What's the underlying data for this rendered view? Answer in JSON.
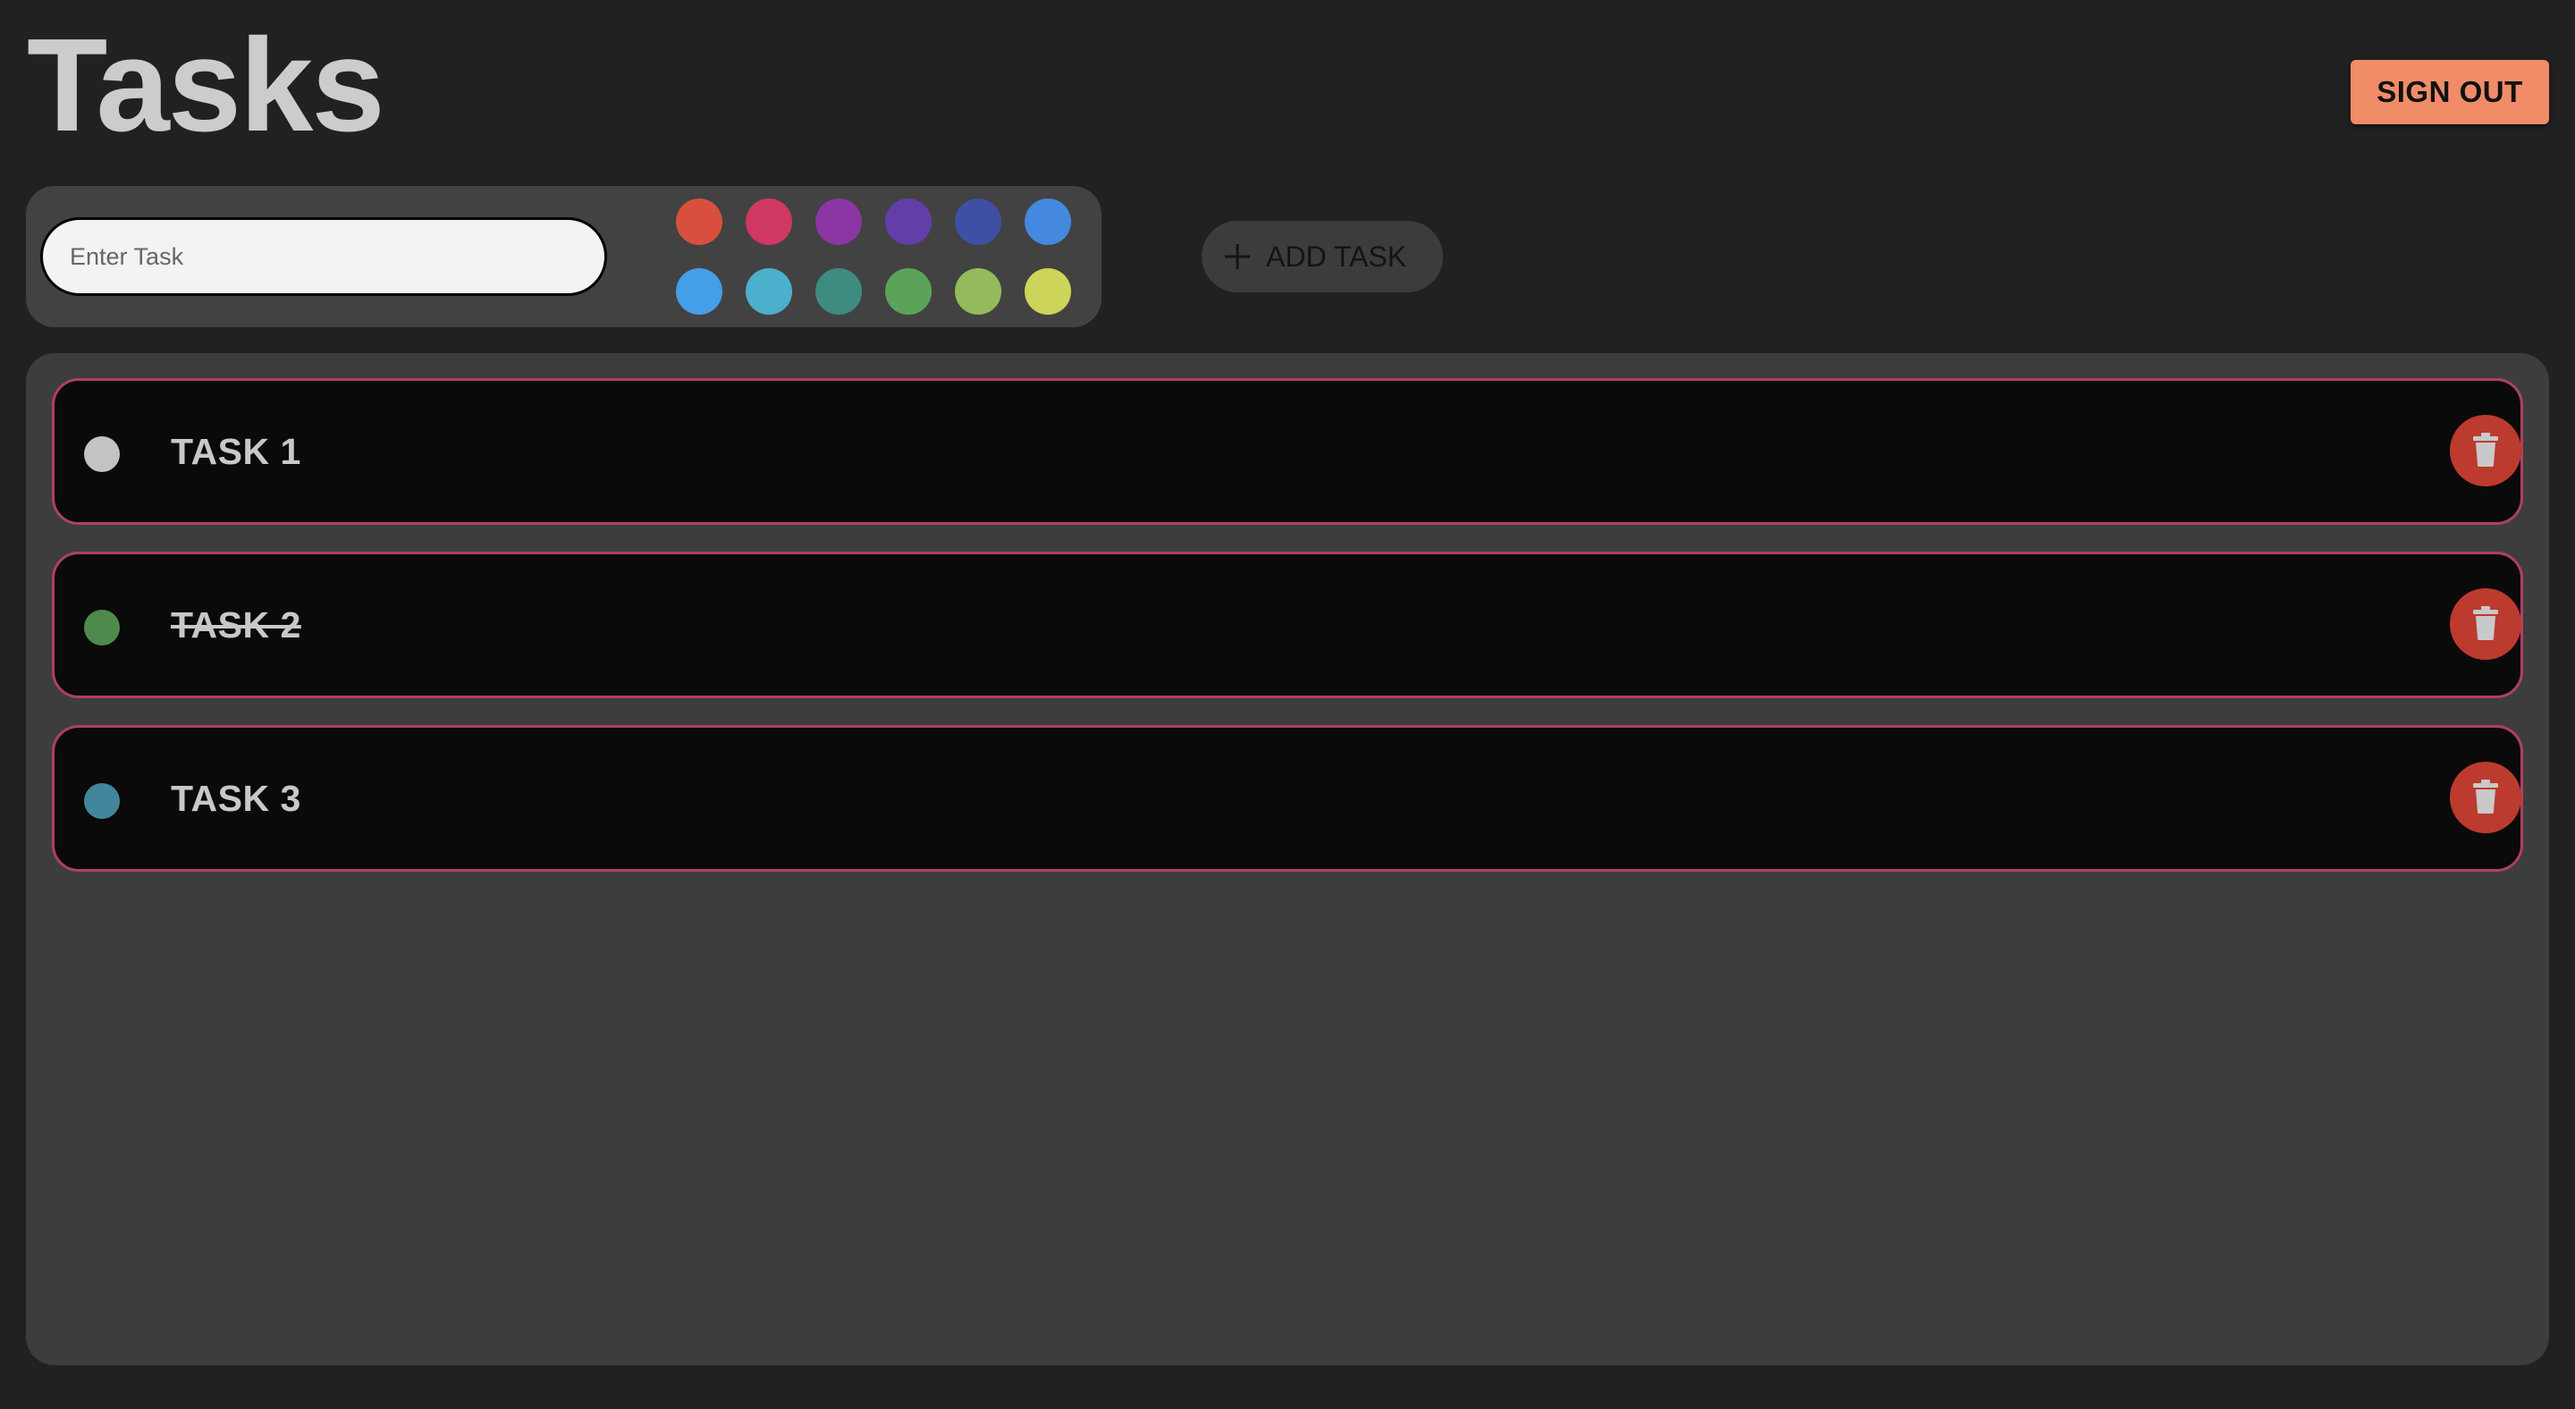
{
  "header": {
    "title": "Tasks",
    "sign_out_label": "SIGN OUT"
  },
  "composer": {
    "input_placeholder": "Enter Task",
    "input_value": "",
    "add_task_label": "ADD TASK",
    "colors": [
      "#d84f3e",
      "#cf3863",
      "#8c35a5",
      "#633ea8",
      "#3f4fa5",
      "#4489df",
      "#449ee8",
      "#4cb0cc",
      "#3e8c80",
      "#5ca35a",
      "#93bb5b",
      "#cdd45a"
    ]
  },
  "tasks": [
    {
      "label": "TASK 1",
      "color": "#c3c3c3",
      "completed": false
    },
    {
      "label": "TASK 2",
      "color": "#4e8a4b",
      "completed": true
    },
    {
      "label": "TASK 3",
      "color": "#42869b",
      "completed": false
    }
  ],
  "theme": {
    "background": "#212121",
    "panel": "#3d3d3d",
    "task_border": "#b03f63",
    "delete": "#bd3a2e",
    "sign_out": "#f08c68"
  }
}
